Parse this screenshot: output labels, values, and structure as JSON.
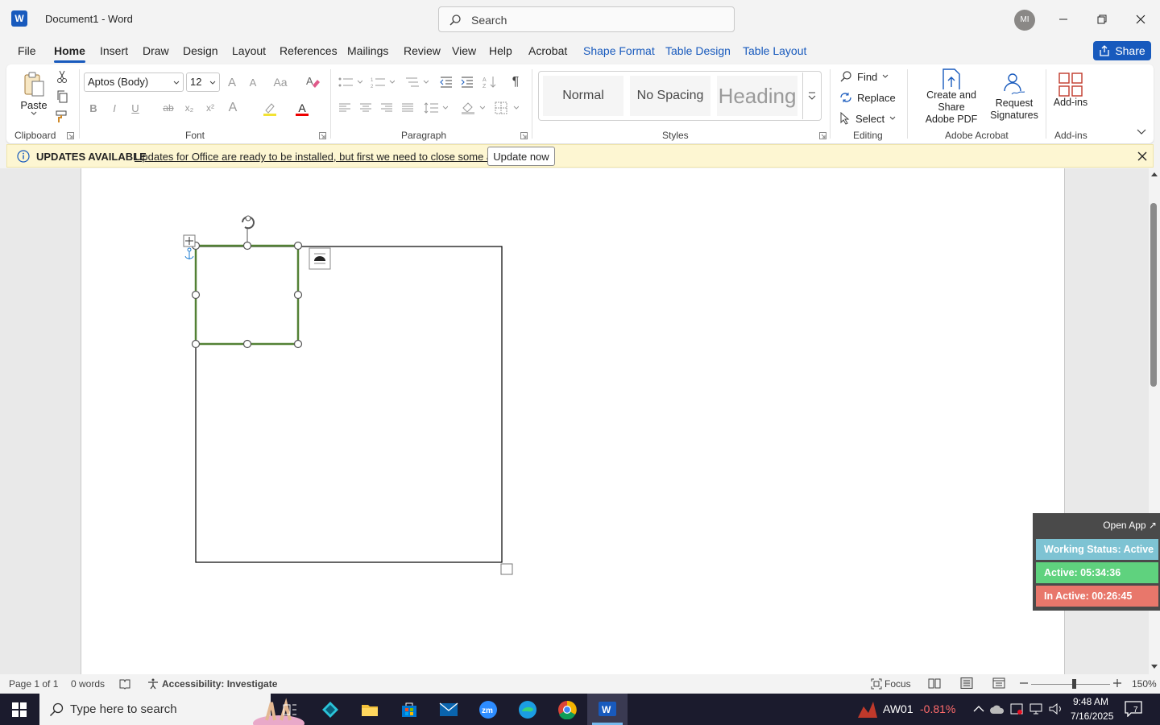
{
  "titlebar": {
    "app_title": "Document1 - Word",
    "search_placeholder": "Search",
    "avatar_initials": "MI"
  },
  "tabs": [
    "File",
    "Home",
    "Insert",
    "Draw",
    "Design",
    "Layout",
    "References",
    "Mailings",
    "Review",
    "View",
    "Help",
    "Acrobat",
    "Shape Format",
    "Table Design",
    "Table Layout"
  ],
  "share_label": "Share",
  "ribbon": {
    "clipboard": {
      "paste": "Paste",
      "label": "Clipboard"
    },
    "font": {
      "name": "Aptos (Body)",
      "size": "12",
      "label": "Font",
      "bold": "B",
      "italic": "I",
      "underline": "U",
      "strike": "ab",
      "subscript": "x₂",
      "superscript": "x²",
      "grow": "A",
      "shrink": "A",
      "case": "Aa",
      "effects": "A",
      "color": "A"
    },
    "paragraph": {
      "label": "Paragraph"
    },
    "styles": {
      "items": [
        "Normal",
        "No Spacing",
        "Heading"
      ],
      "label": "Styles"
    },
    "editing": {
      "find": "Find",
      "replace": "Replace",
      "select": "Select",
      "label": "Editing"
    },
    "acrobat": {
      "create": "Create and Share Adobe PDF",
      "create_line1": "Create and Share",
      "create_line2": "Adobe PDF",
      "request": "Request Signatures",
      "request_line1": "Request",
      "request_line2": "Signatures",
      "label": "Adobe Acrobat"
    },
    "addins": {
      "button": "Add-ins",
      "label": "Add-ins"
    }
  },
  "update_bar": {
    "title": "UPDATES AVAILABLE",
    "message": "Updates for Office are ready to be installed, but first we need to close some apps.",
    "button": "Update now"
  },
  "status": {
    "page": "Page 1 of 1",
    "words": "0 words",
    "accessibility": "Accessibility: Investigate",
    "focus": "Focus",
    "zoom": "150%"
  },
  "widget": {
    "open_app": "Open App ↗",
    "working_status": "Working Status: Active",
    "active": "Active: 05:34:36",
    "inactive": "In Active: 00:26:45",
    "colors": {
      "working": "#7ec3d3",
      "active": "#5fd27e",
      "inactive": "#e8776b"
    }
  },
  "taskbar": {
    "search_placeholder": "Type here to search",
    "stock_name": "AW01",
    "stock_change": "-0.81%",
    "time": "9:48 AM",
    "date": "7/16/2025",
    "notifications": "7"
  },
  "colors": {
    "accent": "#185abd",
    "shape_border": "#538135"
  }
}
